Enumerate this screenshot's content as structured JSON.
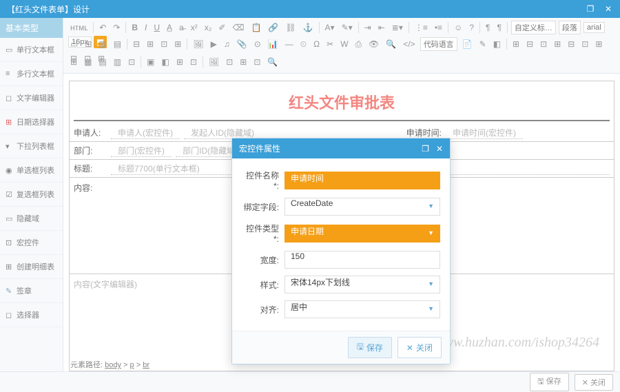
{
  "window": {
    "title": "【红头文件表单】设计"
  },
  "sidebar": {
    "header": "基本类型",
    "items": [
      {
        "label": "单行文本框"
      },
      {
        "label": "多行文本框"
      },
      {
        "label": "文字编辑器"
      },
      {
        "label": "日期选择器"
      },
      {
        "label": "下拉列表框"
      },
      {
        "label": "单选框列表"
      },
      {
        "label": "复选框列表"
      },
      {
        "label": "隐藏域"
      },
      {
        "label": "宏控件"
      },
      {
        "label": "创建明细表"
      },
      {
        "label": "签章"
      },
      {
        "label": "选择器"
      }
    ]
  },
  "toolbar_selects": {
    "custom": "自定义标…",
    "para": "段落",
    "font": "arial",
    "size": "16px",
    "source": "代码语言"
  },
  "doc": {
    "title": "红头文件审批表",
    "row1_label1": "申请人:",
    "row1_ph1": "申请人(宏控件)",
    "row1_ph2": "发起人ID(隐藏域)",
    "row1_label2": "申请时间:",
    "row1_ph3": "申请时间(宏控件)",
    "row2_label": "部门:",
    "row2_ph1": "部门(宏控件)",
    "row2_ph2": "部门ID(隐藏域)",
    "row3_label": "标题:",
    "row3_ph": "标题7700(单行文本框)",
    "row4_label": "内容:",
    "row5_ph": "内容(文字编辑器)"
  },
  "path": {
    "prefix": "元素路径:",
    "seg1": "body",
    "seg2": "p",
    "seg3": "br"
  },
  "footer": {
    "save": "保存",
    "close": "关闭"
  },
  "modal": {
    "title": "宏控件属性",
    "rows": {
      "name_label": "控件名称*:",
      "name_value": "申请时间",
      "field_label": "绑定字段:",
      "field_value": "CreateDate",
      "type_label": "控件类型*:",
      "type_value": "申请日期",
      "width_label": "宽度:",
      "width_value": "150",
      "style_label": "样式:",
      "style_value": "宋体14px下划线",
      "align_label": "对齐:",
      "align_value": "居中"
    },
    "save": "保存",
    "close": "关闭"
  },
  "watermark": "https://www.huzhan.com/ishop34264"
}
